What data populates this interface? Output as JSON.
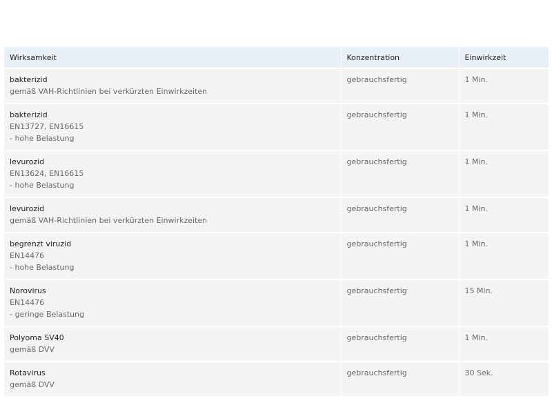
{
  "table": {
    "headers": [
      "Wirksamkeit",
      "Konzentration",
      "Einwirkzeit"
    ],
    "rows": [
      {
        "title": "bakterizid",
        "lines": [
          "gemäß VAH-Richtlinien bei verkürzten Einwirkzeiten"
        ],
        "konzentration": "gebrauchsfertig",
        "einwirkzeit": "1 Min."
      },
      {
        "title": "bakterizid",
        "lines": [
          "EN13727, EN16615",
          "- hohe Belastung"
        ],
        "konzentration": "gebrauchsfertig",
        "einwirkzeit": "1 Min."
      },
      {
        "title": "levurozid",
        "lines": [
          "EN13624, EN16615",
          "- hohe Belastung"
        ],
        "konzentration": "gebrauchsfertig",
        "einwirkzeit": "1 Min."
      },
      {
        "title": "levurozid",
        "lines": [
          "gemäß VAH-Richtlinien bei verkürzten Einwirkzeiten"
        ],
        "konzentration": "gebrauchsfertig",
        "einwirkzeit": "1 Min."
      },
      {
        "title": "begrenzt viruzid",
        "lines": [
          "EN14476",
          "- hohe Belastung"
        ],
        "konzentration": "gebrauchsfertig",
        "einwirkzeit": "1 Min."
      },
      {
        "title": "Norovirus",
        "lines": [
          "EN14476",
          "- geringe Belastung"
        ],
        "konzentration": "gebrauchsfertig",
        "einwirkzeit": "15 Min."
      },
      {
        "title": "Polyoma SV40",
        "lines": [
          "gemäß DVV"
        ],
        "konzentration": "gebrauchsfertig",
        "einwirkzeit": "1 Min."
      },
      {
        "title": "Rotavirus",
        "lines": [
          "gemäß DVV"
        ],
        "konzentration": "gebrauchsfertig",
        "einwirkzeit": "30 Sek."
      }
    ]
  }
}
